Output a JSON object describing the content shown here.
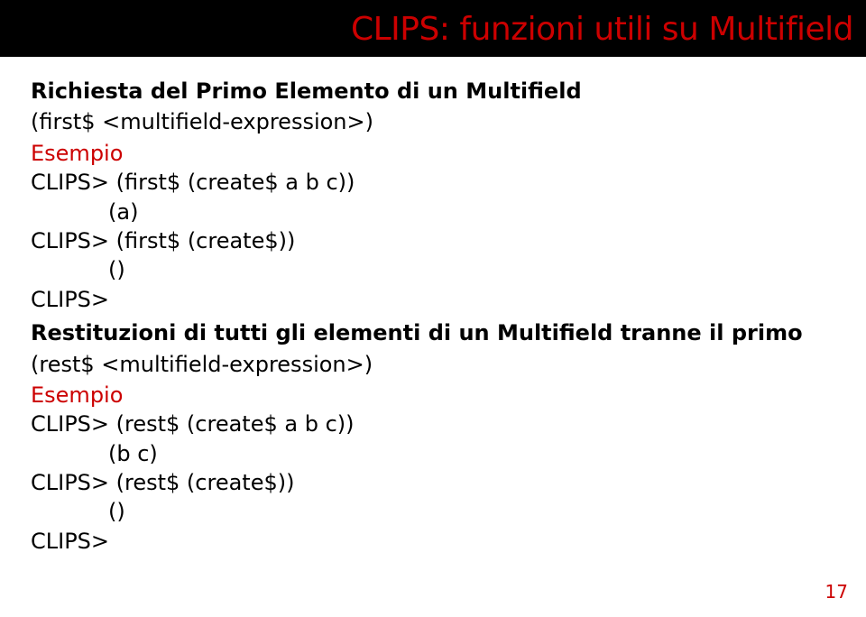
{
  "title": "CLIPS: funzioni utili su Multifield",
  "section1": {
    "heading": "Richiesta del Primo Elemento di un Multifield",
    "syntax": "(first$ <multifield-expression>)",
    "example_label": "Esempio",
    "lines": [
      "CLIPS> (first$ (create$ a b c))",
      "(a)",
      "CLIPS> (first$ (create$))",
      "()",
      "CLIPS>"
    ]
  },
  "section2": {
    "heading": "Restituzioni di tutti gli elementi di un Multifield tranne il primo",
    "syntax": "(rest$ <multifield-expression>)",
    "example_label": "Esempio",
    "lines": [
      "CLIPS> (rest$ (create$ a b c))",
      "(b c)",
      "CLIPS> (rest$ (create$))",
      "()",
      "CLIPS>"
    ]
  },
  "page_number": "17"
}
